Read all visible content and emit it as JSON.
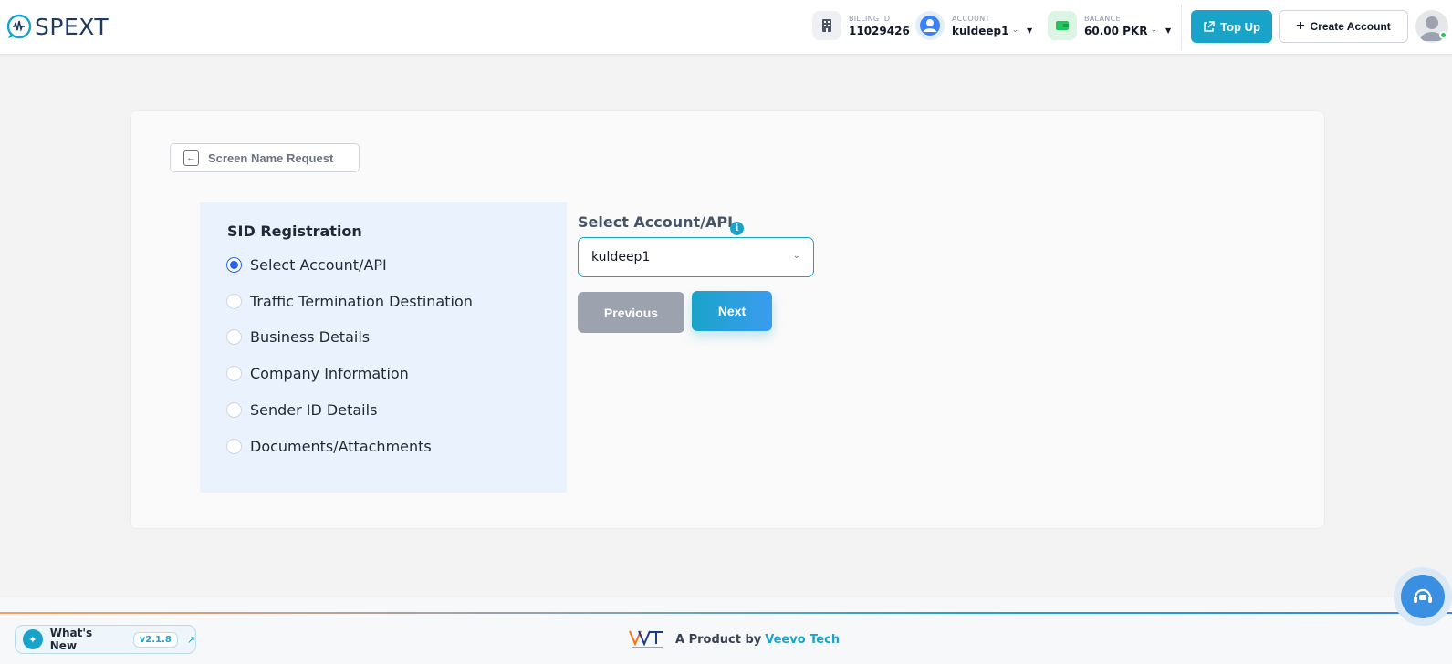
{
  "header": {
    "logo_text": "SPEXT",
    "billing": {
      "label": "BILLING ID",
      "value": "11029426"
    },
    "account": {
      "label": "ACCOUNT",
      "value": "kuldeep1"
    },
    "balance": {
      "label": "BALANCE",
      "value": "60.00 PKR"
    },
    "topup_label": "Top Up",
    "create_account_label": "Create Account"
  },
  "back": {
    "label": "Screen Name Request"
  },
  "steps": {
    "title": "SID Registration",
    "items": [
      {
        "label": "Select Account/API",
        "active": true
      },
      {
        "label": "Traffic Termination Destination",
        "active": false
      },
      {
        "label": "Business Details",
        "active": false
      },
      {
        "label": "Company Information",
        "active": false
      },
      {
        "label": "Sender ID Details",
        "active": false
      },
      {
        "label": "Documents/Attachments",
        "active": false
      }
    ]
  },
  "form": {
    "field_label": "Select Account/API",
    "selected_value": "kuldeep1",
    "previous_label": "Previous",
    "next_label": "Next"
  },
  "footer": {
    "whats_new_label": "What's New",
    "version": "v2.1.8",
    "product_prefix": "A Product by",
    "product_brand": "Veevo Tech"
  },
  "colors": {
    "accent": "#1aa3c9",
    "radio_active": "#2563eb",
    "steps_bg": "#eaf3fd",
    "prev_button": "#9ca3af"
  },
  "icons": {
    "billing": "building-icon",
    "account": "user-circle-icon",
    "balance": "wallet-icon",
    "topup": "external-link-icon",
    "create": "plus-icon",
    "back": "arrow-left-box-icon",
    "info": "info-icon",
    "chat": "headset-icon"
  }
}
